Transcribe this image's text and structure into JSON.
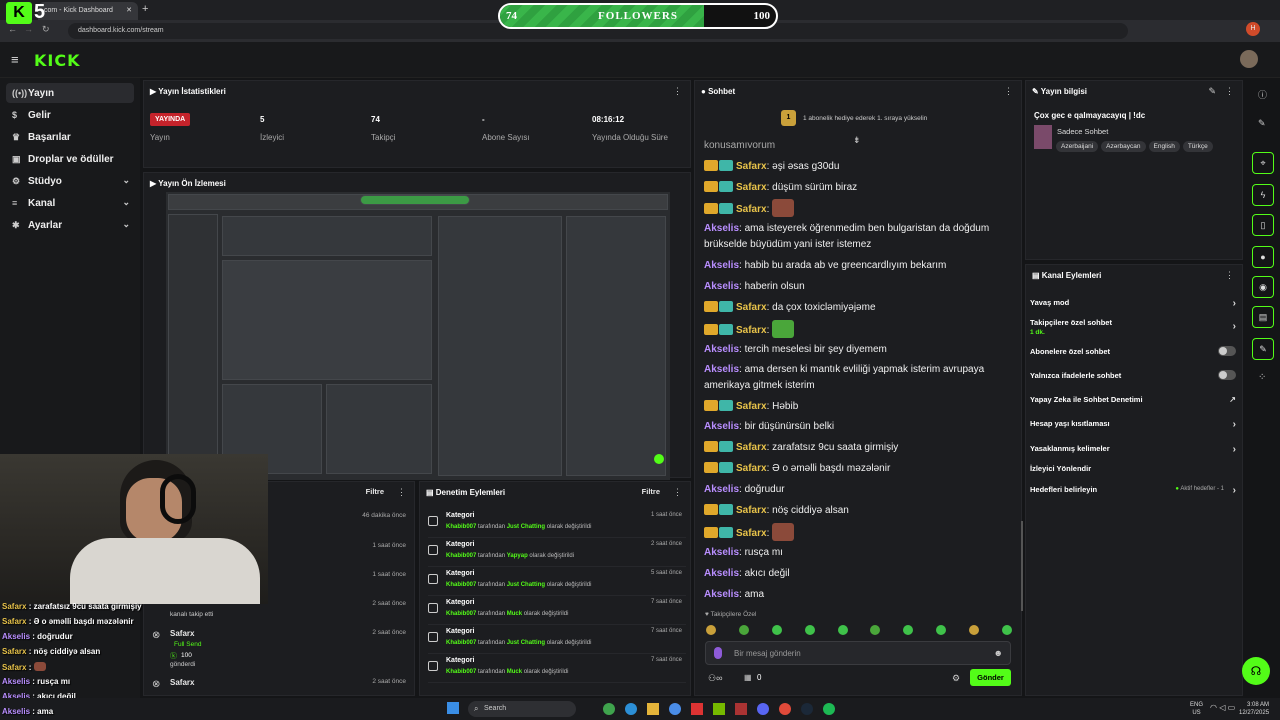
{
  "browser": {
    "tab_title": "com - Kick Dashboard",
    "url": "dashboard.kick.com/stream",
    "new_tab": "+"
  },
  "overlay": {
    "kick_number": "5",
    "followers_current": "74",
    "followers_label": "FOLLOWERS",
    "followers_goal": "100",
    "followers_progress": 0.74
  },
  "app": {
    "logo": "KICK"
  },
  "sidebar": {
    "items": [
      {
        "label": "Yayın",
        "icon": "broadcast-icon"
      },
      {
        "label": "Gelir",
        "icon": "dollar-icon"
      },
      {
        "label": "Başarılar",
        "icon": "trophy-icon"
      },
      {
        "label": "Droplar ve ödüller",
        "icon": "gift-icon"
      },
      {
        "label": "Stüdyo",
        "icon": "settings-icon"
      },
      {
        "label": "Kanal",
        "icon": "bars-icon"
      },
      {
        "label": "Ayarlar",
        "icon": "gear-icon"
      }
    ]
  },
  "stats": {
    "title": "Yayın İstatistikleri",
    "live_badge": "YAYINDA",
    "live_label": "Yayın",
    "viewers_value": "5",
    "viewers_label": "İzleyici",
    "followers_value": "74",
    "followers_label": "Takipçi",
    "subs_value": "-",
    "subs_label": "Abone Sayısı",
    "uptime_value": "08:16:12",
    "uptime_label": "Yayında Olduğu Süre"
  },
  "preview": {
    "title": "Yayın Ön İzlemesi"
  },
  "activity": {
    "filter": "Filtre",
    "rows": [
      {
        "time": "46 dakika önce"
      },
      {
        "time": "1 saat önce"
      },
      {
        "time": "1 saat önce"
      },
      {
        "time": "2 saat önce",
        "line": "kanalı takip etti"
      },
      {
        "time": "2 saat önce",
        "name": "Safarx",
        "line1": "Full Send",
        "line2": "100",
        "line3": "gönderdi"
      },
      {
        "time": "2 saat önce",
        "name": "Safarx"
      }
    ]
  },
  "moderation": {
    "title": "Denetim Eylemleri",
    "filter": "Filtre",
    "rows": [
      {
        "title": "Kategori",
        "user": "Khabib007",
        "mid": "tarafından",
        "cat": "Just Chatting",
        "tail": "olarak değiştirildi",
        "time": "1 saat önce"
      },
      {
        "title": "Kategori",
        "user": "Khabib007",
        "mid": "tarafından",
        "cat": "Yapyap",
        "tail": "olarak değiştirildi",
        "time": "2 saat önce"
      },
      {
        "title": "Kategori",
        "user": "Khabib007",
        "mid": "tarafından",
        "cat": "Just Chatting",
        "tail": "olarak değiştirildi",
        "time": "5 saat önce"
      },
      {
        "title": "Kategori",
        "user": "Khabib007",
        "mid": "tarafından",
        "cat": "Muck",
        "tail": "olarak değiştirildi",
        "time": "7 saat önce"
      },
      {
        "title": "Kategori",
        "user": "Khabib007",
        "mid": "tarafından",
        "cat": "Just Chatting",
        "tail": "olarak değiştirildi",
        "time": "7 saat önce"
      },
      {
        "title": "Kategori",
        "user": "Khabib007",
        "mid": "tarafından",
        "cat": "Muck",
        "tail": "olarak değiştirildi",
        "time": "7 saat önce"
      }
    ]
  },
  "chat": {
    "title": "Sohbet",
    "gift_rank": "1",
    "gift_text": "1 abonelik hediye ederek 1. sıraya yükselin",
    "partial_top": "konuşamıyorum",
    "messages": [
      {
        "user": "Safarx",
        "text": "əşi əsas g30du",
        "type": "sf"
      },
      {
        "user": "Safarx",
        "text": "düşüm sürüm biraz",
        "type": "sf"
      },
      {
        "user": "Safarx",
        "text": "",
        "type": "sf",
        "emote": "#8b4a3a"
      },
      {
        "user": "Akselis",
        "text": "ama isteyerek öğrenmedim ben bulgaristan da doğdum brükselde büyüdüm yani ister istemez",
        "type": "ak"
      },
      {
        "user": "Akselis",
        "text": "habib bu arada ab ve greencardlıyım bekarım",
        "type": "ak"
      },
      {
        "user": "Akselis",
        "text": "haberin olsun",
        "type": "ak"
      },
      {
        "user": "Safarx",
        "text": "da çox toxicləmiyəjəme",
        "type": "sf"
      },
      {
        "user": "Safarx",
        "text": "",
        "type": "sf",
        "emote": "#4aa63a"
      },
      {
        "user": "Akselis",
        "text": "tercih meselesi bir şey diyemem",
        "type": "ak"
      },
      {
        "user": "Akselis",
        "text": "ama dersen ki mantık evliliği yapmak isterim avrupaya amerikaya gitmek isterim",
        "type": "ak"
      },
      {
        "user": "Safarx",
        "text": "Həbib",
        "type": "sf"
      },
      {
        "user": "Akselis",
        "text": "bir düşünürsün belki",
        "type": "ak"
      },
      {
        "user": "Safarx",
        "text": "zarafatsız 9cu saata girmişiy",
        "type": "sf"
      },
      {
        "user": "Safarx",
        "text": "Ə o əməlli başdı məzələnir",
        "type": "sf"
      },
      {
        "user": "Akselis",
        "text": "doğrudur",
        "type": "ak"
      },
      {
        "user": "Safarx",
        "text": "nöş ciddiyə alsan",
        "type": "sf"
      },
      {
        "user": "Safarx",
        "text": "",
        "type": "sf",
        "emote": "#8b4a3a"
      },
      {
        "user": "Akselis",
        "text": "rusça mı",
        "type": "ak"
      },
      {
        "user": "Akselis",
        "text": "akıcı değil",
        "type": "ak"
      },
      {
        "user": "Akselis",
        "text": "ama",
        "type": "ak"
      }
    ],
    "followers_only": "Takipçilere Özel",
    "input_placeholder": "Bir mesaj gönderin",
    "points": "0",
    "send": "Gönder"
  },
  "stream_info": {
    "title": "Yayın bilgisi",
    "stream_title": "Çox gec e qalmayacayıq | !dc",
    "category": "Sadece Sohbet",
    "tags": [
      "Azerbaijani",
      "Azərbaycan",
      "English",
      "Türkçe"
    ]
  },
  "channel_actions": {
    "title": "Kanal Eylemleri",
    "slow_mode": "Yavaş mod",
    "followers_chat": "Takipçilere özel sohbet",
    "followers_chat_sub": "1 dk.",
    "subs_chat": "Abonelere özel sohbet",
    "emote_chat": "Yalnızca ifadelerle sohbet",
    "ai_mod": "Yapay Zeka ile Sohbet Denetimi",
    "age_restrict": "Hesap yaşı kısıtlaması",
    "banned_words": "Yasaklanmış kelimeler",
    "viewer_redirect": "İzleyici Yönlendir",
    "set_goals": "Hedefleri belirleyin",
    "goal_status": "Aktif hedefler - 1"
  },
  "overlay_chat": [
    {
      "user": "Safarx",
      "text": "zarafatsız 9cu saata girmişiy"
    },
    {
      "user": "Safarx",
      "text": "Ə o əməlli başdı məzələnir"
    },
    {
      "user": "Akselis",
      "text": "doğrudur"
    },
    {
      "user": "Safarx",
      "text": "nöş ciddiyə alsan"
    },
    {
      "user": "Safarx",
      "text": ""
    },
    {
      "user": "Akselis",
      "text": "rusça mı"
    },
    {
      "user": "Akselis",
      "text": "akıcı değil"
    },
    {
      "user": "Akselis",
      "text": "ama"
    }
  ],
  "taskbar": {
    "search": "Search",
    "lang": "ENG",
    "region": "US",
    "time": "3:08 AM",
    "date": "12/27/2025"
  }
}
